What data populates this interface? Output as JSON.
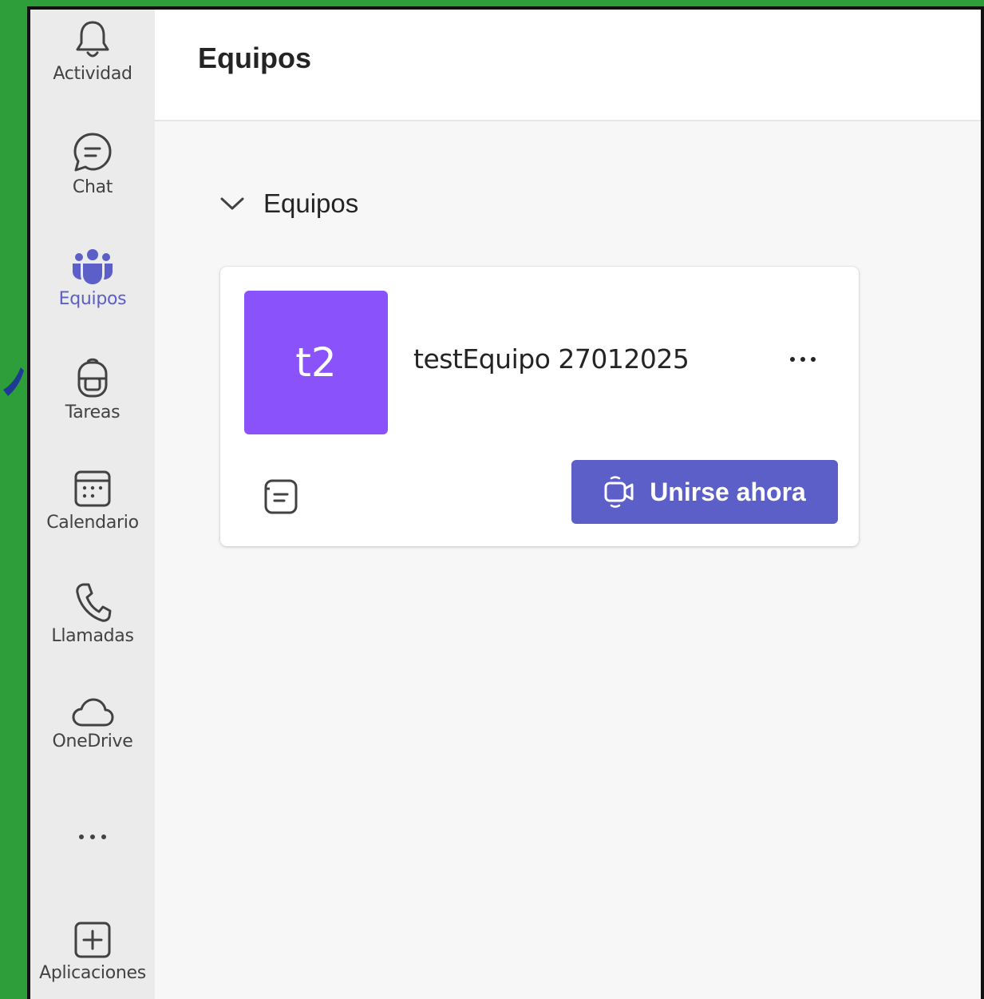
{
  "rail": {
    "items": [
      {
        "label": "Actividad",
        "icon": "bell-icon"
      },
      {
        "label": "Chat",
        "icon": "chat-icon"
      },
      {
        "label": "Equipos",
        "icon": "teams-icon"
      },
      {
        "label": "Tareas",
        "icon": "backpack-icon"
      },
      {
        "label": "Calendario",
        "icon": "calendar-icon"
      },
      {
        "label": "Llamadas",
        "icon": "phone-icon"
      },
      {
        "label": "OneDrive",
        "icon": "cloud-icon"
      },
      {
        "label": "Aplicaciones",
        "icon": "add-apps-icon"
      }
    ],
    "more_icon": "more-horizontal-icon",
    "active": "Equipos"
  },
  "header": {
    "title": "Equipos"
  },
  "section": {
    "label": "Equipos",
    "expanded": true
  },
  "team": {
    "initials": "t2",
    "name": "testEquipo 27012025",
    "avatar_color": "#8a52fb",
    "join_label": "Unirse ahora"
  },
  "colors": {
    "accent": "#5b5fc7",
    "rail_bg": "#ebebeb",
    "frame_green": "#2e9e3a"
  }
}
